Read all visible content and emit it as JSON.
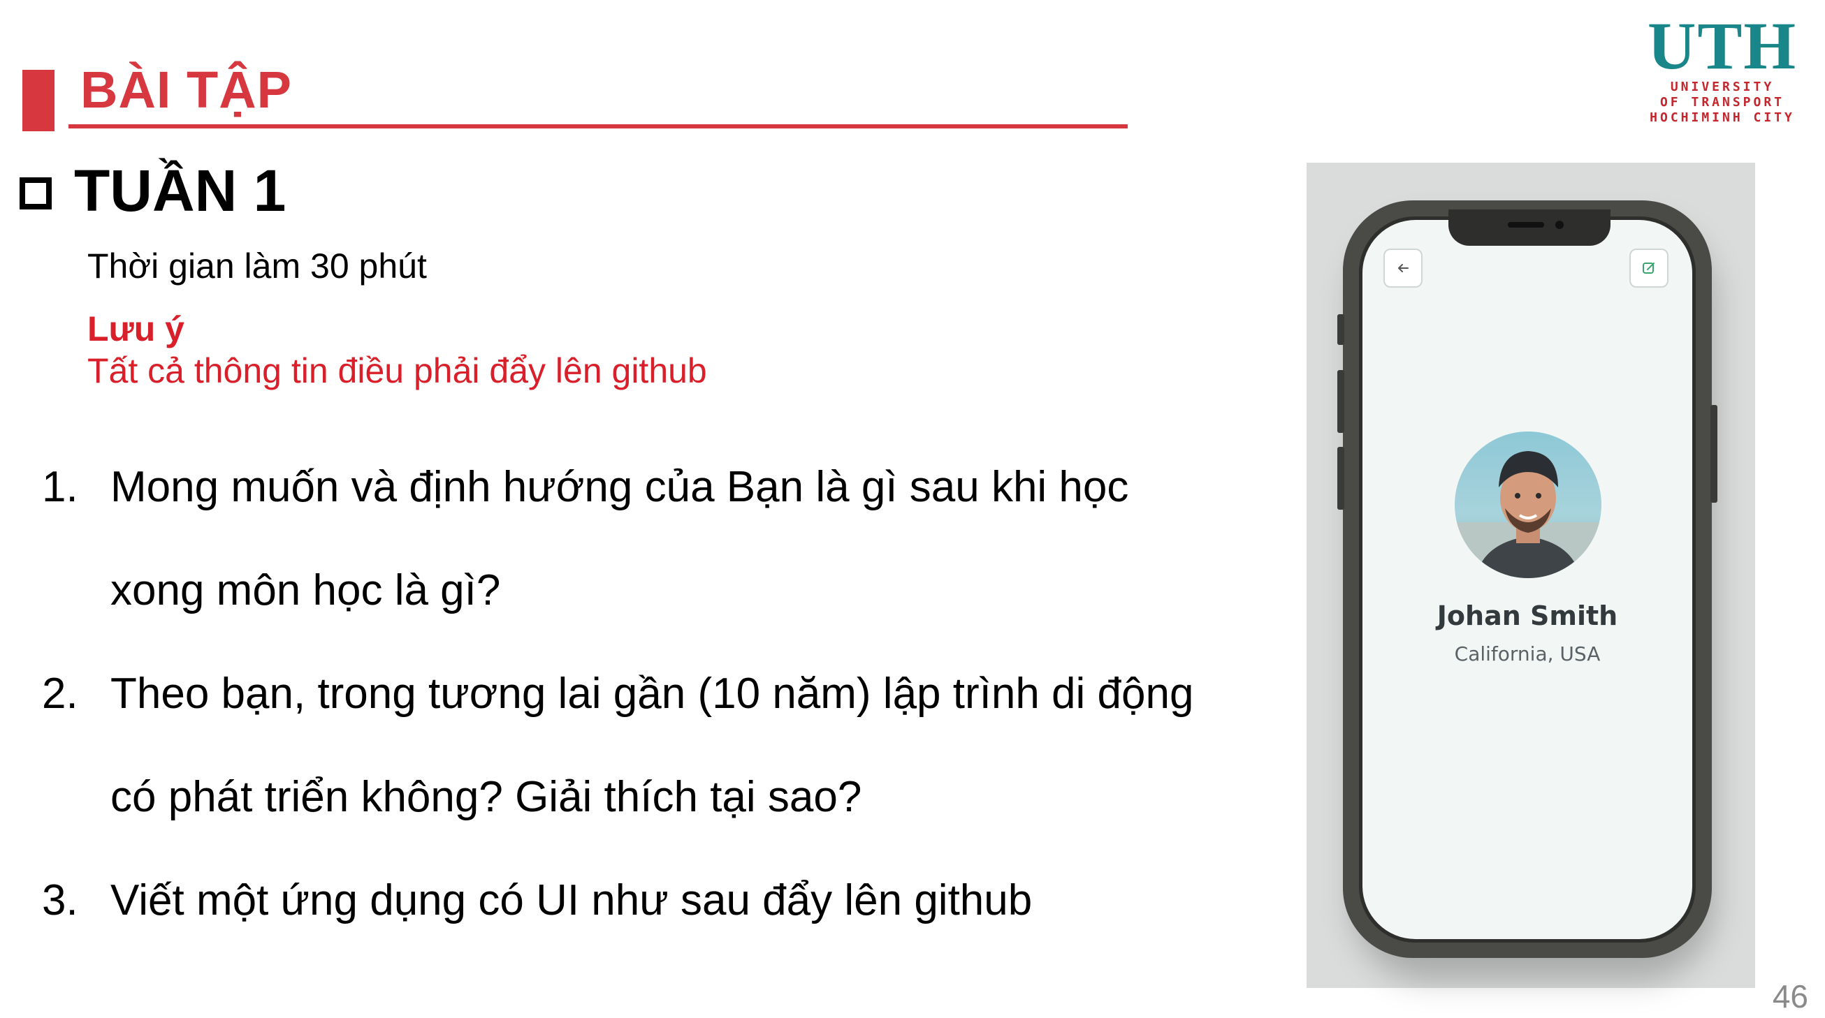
{
  "header": {
    "title": "BÀI TẬP",
    "accent_color": "#d7373f"
  },
  "logo": {
    "mark": "UTH",
    "line1": "UNIVERSITY",
    "line2": "OF TRANSPORT",
    "line3": "HOCHIMINH CITY"
  },
  "section": {
    "title": "TUẦN 1",
    "icon": "checkbox-square-icon"
  },
  "time_note": "Thời gian làm 30 phút",
  "note": {
    "label": "Lưu ý",
    "text": "Tất cả thông tin điều phải đẩy lên github",
    "color": "#d9202a"
  },
  "questions": [
    {
      "num": "1.",
      "line1": "Mong muốn và định hướng của Bạn là gì sau khi học",
      "line2": "xong môn học là gì?"
    },
    {
      "num": "2.",
      "line1": "Theo bạn, trong tương lai gần (10 năm) lập trình di động",
      "line2": "có phát triển không? Giải thích tại sao?"
    },
    {
      "num": "3.",
      "line1": "Viết một ứng dụng có UI như sau đẩy lên github"
    }
  ],
  "phone_mockup": {
    "back_icon": "arrow-left-icon",
    "edit_icon": "edit-square-icon",
    "profile_name": "Johan Smith",
    "profile_location": "California, USA",
    "avatar": "avatar-photo"
  },
  "page_number": "46"
}
